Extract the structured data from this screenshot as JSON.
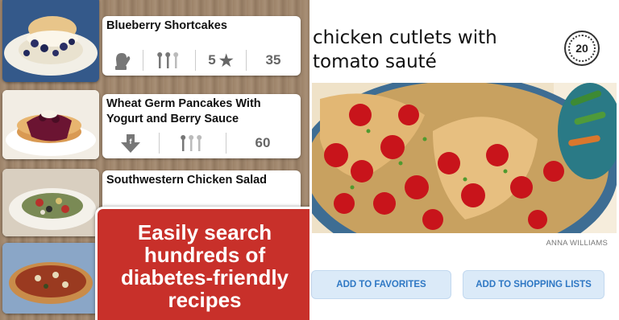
{
  "recipes": [
    {
      "title": "Blueberry Shortcakes",
      "servings": "5",
      "calories": "35"
    },
    {
      "title": "Wheat Germ Pancakes With Yogurt and Berry Sauce",
      "calories": "60"
    },
    {
      "title": "Southwestern Chicken Salad"
    }
  ],
  "banner": {
    "text": "Easily search hundreds of diabetes-friendly recipes"
  },
  "detail": {
    "title": "chicken cutlets with tomato sauté",
    "time": "20",
    "photo_credit": "ANNA WILLIAMS",
    "favorites_label": "ADD TO FAVORITES",
    "shopping_label": "ADD TO SHOPPING LISTS"
  }
}
